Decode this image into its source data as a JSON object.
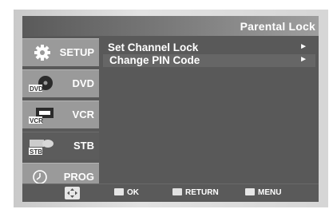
{
  "title": "Parental Lock",
  "sidebar": {
    "items": [
      {
        "label": "SETUP",
        "icon": "gear-icon",
        "active": false
      },
      {
        "label": "DVD",
        "icon": "dvd-disc-icon",
        "icon_text": "DVD",
        "active": false
      },
      {
        "label": "VCR",
        "icon": "vcr-tape-icon",
        "icon_text": "VCR",
        "active": false
      },
      {
        "label": "STB",
        "icon": "stb-box-icon",
        "icon_text": "STB",
        "active": true
      },
      {
        "label": "PROG",
        "icon": "clock-icon",
        "active": false
      }
    ]
  },
  "menu": {
    "items": [
      {
        "label": "Set Channel Lock",
        "arrow": "►"
      },
      {
        "label": "Change  PIN Code",
        "arrow": "►"
      }
    ]
  },
  "bottombar": {
    "nav_icon": "directional-pad-icon",
    "ok_label": "OK",
    "return_label": "RETURN",
    "menu_label": "MENU"
  }
}
